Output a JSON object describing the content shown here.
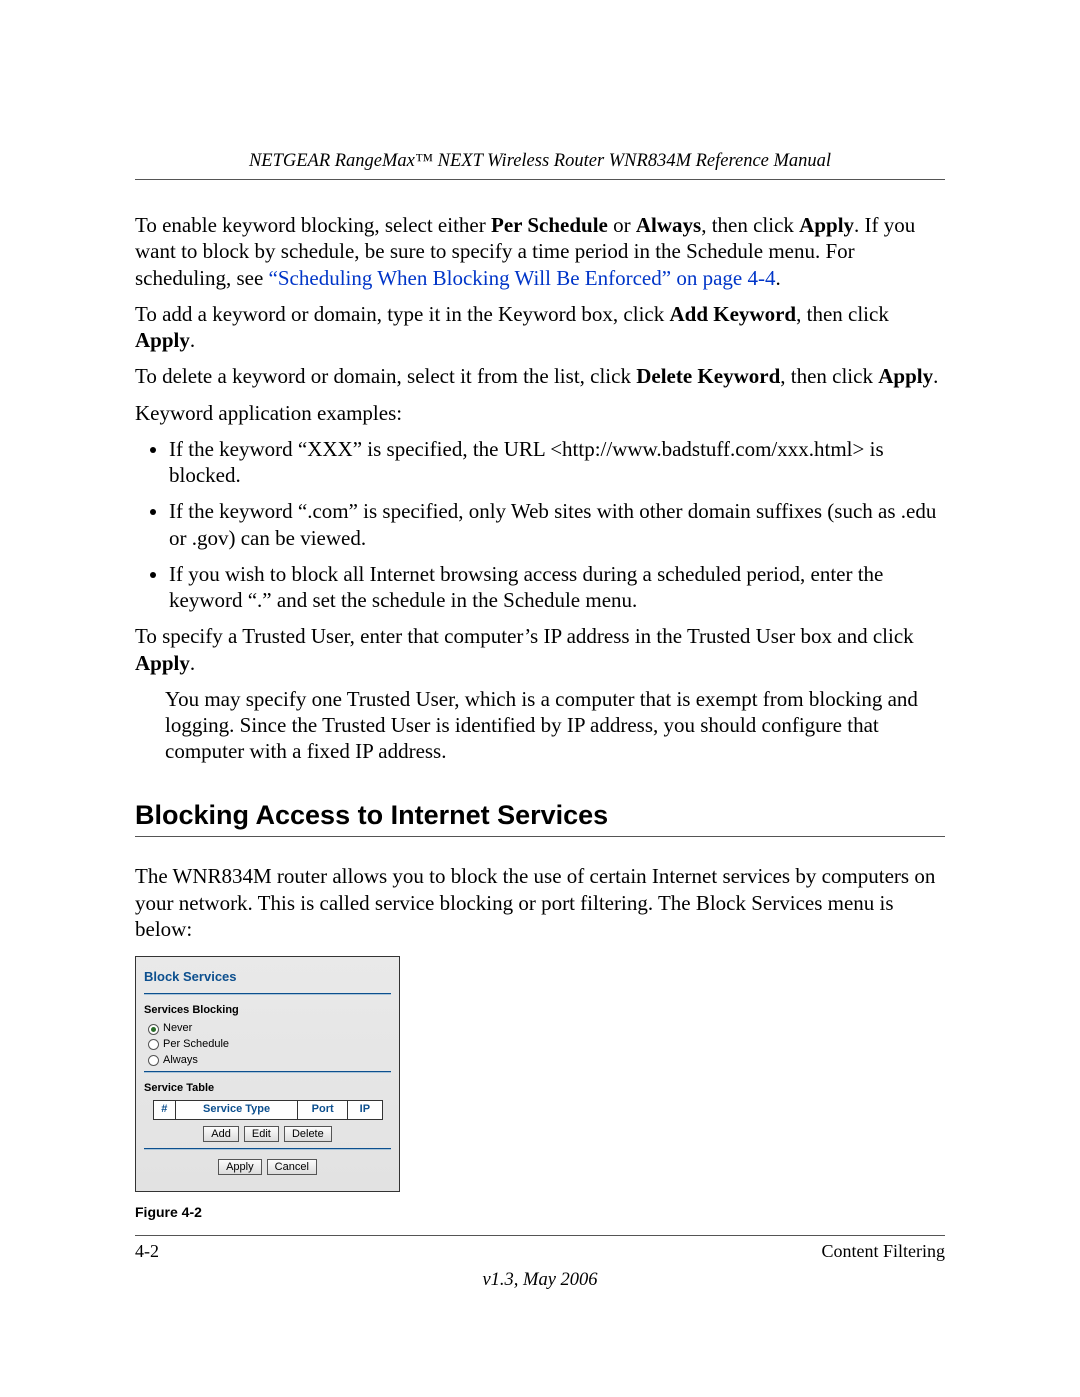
{
  "header": {
    "running_title": "NETGEAR RangeMax™ NEXT Wireless Router WNR834M Reference Manual"
  },
  "para1": {
    "pre": "To enable keyword blocking, select either ",
    "b1": "Per Schedule",
    "mid1": " or ",
    "b2": "Always",
    "mid2": ", then click ",
    "b3": "Apply",
    "post": ". If you want to block by schedule, be sure to specify a time period in the Schedule menu. For scheduling, see ",
    "link": "“Scheduling When Blocking Will Be Enforced” on page 4-4",
    "end": "."
  },
  "para2": {
    "pre": "To add a keyword or domain, type it in the Keyword box, click ",
    "b1": "Add Keyword",
    "mid": ", then click ",
    "b2": "Apply",
    "end": "."
  },
  "para3": {
    "pre": "To delete a keyword or domain, select it from the list, click ",
    "b1": "Delete Keyword",
    "mid": ", then click ",
    "b2": "Apply",
    "end": "."
  },
  "para4": "Keyword application examples:",
  "bullets": {
    "b0": "If the keyword “XXX” is specified, the URL <http://www.badstuff.com/xxx.html> is blocked.",
    "b1": "If the keyword “.com” is specified, only Web sites with other domain suffixes (such as .edu or .gov) can be viewed.",
    "b2": "If you wish to block all Internet browsing access during a scheduled period, enter the keyword “.” and set the schedule in the Schedule menu."
  },
  "para5": {
    "pre": "To specify a Trusted User, enter that computer’s IP address in the Trusted User box and click ",
    "b1": "Apply",
    "end": "."
  },
  "note": "You may specify one Trusted User, which is a computer that is exempt from blocking and logging. Since the Trusted User is identified by IP address, you should configure that computer with a fixed IP address.",
  "section_heading": "Blocking Access to Internet Services",
  "para6": "The WNR834M router allows you to block the use of certain Internet services by computers on your network. This is called service blocking or port filtering. The Block Services menu is below:",
  "ui": {
    "title": "Block Services",
    "blocking_label": "Services Blocking",
    "radios": {
      "never": "Never",
      "per_schedule": "Per Schedule",
      "always": "Always",
      "selected": "never"
    },
    "table_label": "Service Table",
    "columns": {
      "num": "#",
      "type": "Service Type",
      "port": "Port",
      "ip": "IP"
    },
    "buttons": {
      "add": "Add",
      "edit": "Edit",
      "delete": "Delete",
      "apply": "Apply",
      "cancel": "Cancel"
    }
  },
  "figure_caption": "Figure 4-2",
  "footer": {
    "page_num": "4-2",
    "section": "Content Filtering",
    "version": "v1.3, May 2006"
  }
}
